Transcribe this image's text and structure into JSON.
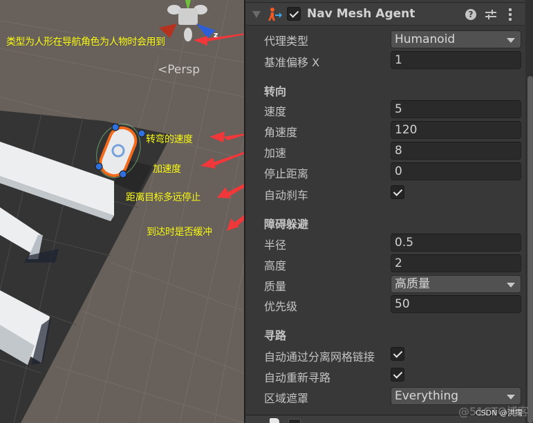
{
  "scene": {
    "view_mode": "<Persp",
    "gizmo_axis_label": "z",
    "annotations": [
      "类型为人形在导航角色为人物时会用到",
      "转弯的速度",
      "加速度",
      "距离目标多远停止",
      "到达时是否缓冲"
    ],
    "colors": {
      "annotation_text": "#ffff1a",
      "arrow": "#f0383a",
      "ground": "#67605b",
      "navmesh_dark": "#343434",
      "selection_outline": "#f26b1d"
    }
  },
  "inspector": {
    "component": {
      "title": "Nav Mesh Agent",
      "enabled": true,
      "help_icon": "?"
    },
    "fields": {
      "agent_type": {
        "label": "代理类型",
        "value": "Humanoid"
      },
      "base_offset": {
        "label": "基准偏移 X",
        "value": "1"
      }
    },
    "steering": {
      "title": "转向",
      "speed": {
        "label": "速度",
        "value": "5"
      },
      "angular_speed": {
        "label": "角速度",
        "value": "120"
      },
      "acceleration": {
        "label": "加速",
        "value": "8"
      },
      "stopping_distance": {
        "label": "停止距离",
        "value": "0"
      },
      "auto_braking": {
        "label": "自动刹车",
        "checked": true
      }
    },
    "obstacle_avoidance": {
      "title": "障碍躲避",
      "radius": {
        "label": "半径",
        "value": "0.5"
      },
      "height": {
        "label": "高度",
        "value": "2"
      },
      "quality": {
        "label": "质量",
        "value": "高质量"
      },
      "priority": {
        "label": "优先级",
        "value": "50"
      }
    },
    "pathfinding": {
      "title": "寻路",
      "auto_traverse_offmesh": {
        "label": "自动通过分离网格链接",
        "checked": true
      },
      "auto_repath": {
        "label": "自动重新寻路",
        "checked": true
      },
      "area_mask": {
        "label": "区域遮罩",
        "value": "Everything"
      }
    }
  },
  "watermarks": [
    "@51CTO博客",
    "CSDN @洪霈"
  ]
}
